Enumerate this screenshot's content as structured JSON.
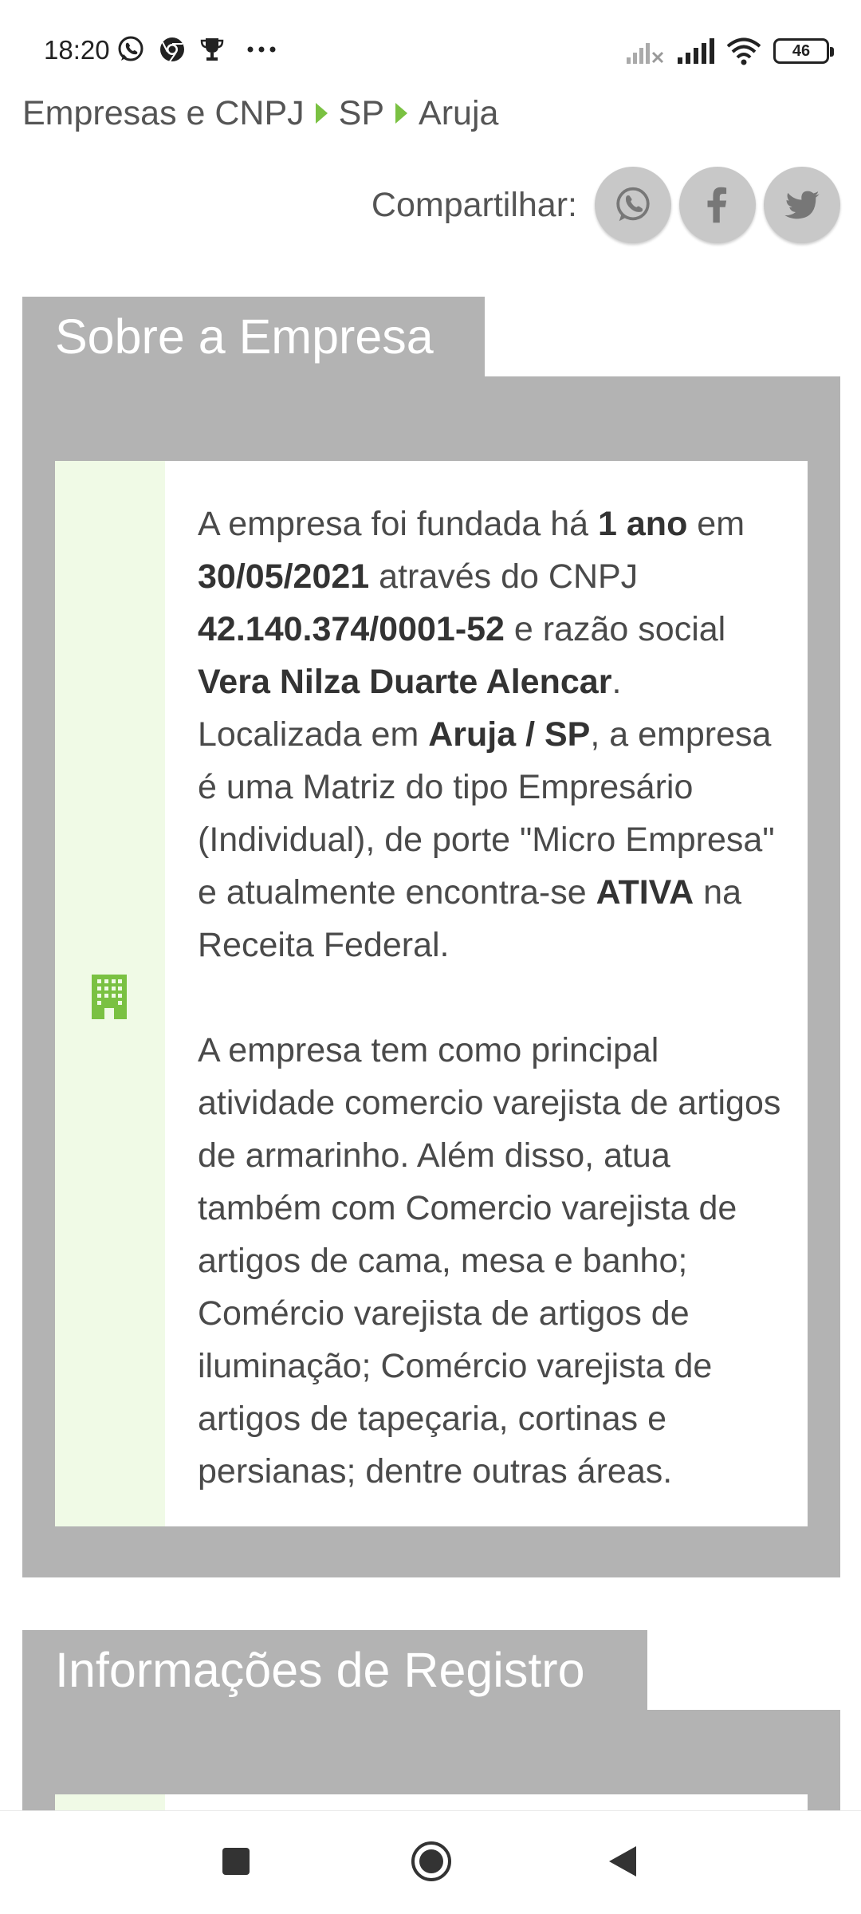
{
  "status_bar": {
    "time": "18:20",
    "battery": "46",
    "icons": [
      "whatsapp-icon",
      "chrome-icon",
      "trophy-icon",
      "more-dots-icon",
      "no-signal-icon",
      "signal-icon",
      "wifi-icon",
      "battery-icon"
    ]
  },
  "breadcrumb": {
    "items": [
      "Empresas e CNPJ",
      "SP",
      "Aruja"
    ]
  },
  "share": {
    "label": "Compartilhar:",
    "buttons": [
      "whatsapp",
      "facebook",
      "twitter"
    ]
  },
  "about": {
    "title": "Sobre a Empresa",
    "p1": {
      "t1": "A empresa foi fundada há ",
      "age": "1 ano",
      "t2": " em ",
      "date": "30/05/2021",
      "t3": " através do CNPJ ",
      "cnpj": "42.140.374/0001-52",
      "t4": " e razão social ",
      "name": "Vera Nilza Duarte Alencar",
      "t5": ". Localizada em ",
      "location": "Aruja / SP",
      "t6": ", a empresa é uma Matriz do tipo Empresário (Individual), de porte \"Micro Empresa\" e atualmente encontra-se ",
      "status": "ATIVA",
      "t7": " na Receita Federal."
    },
    "p2": "A empresa tem como principal atividade comercio varejista de artigos de armarinho. Além disso, atua também com Comercio varejista de artigos de cama, mesa e banho; Comércio varejista de artigos de iluminação; Comércio varejista de artigos de tapeçaria, cortinas e persianas; dentre outras áreas."
  },
  "registro": {
    "title": "Informações de Registro"
  },
  "colors": {
    "accent_green": "#7ac142",
    "section_gray": "#b3b3b3",
    "side_green": "#f0fae6"
  }
}
